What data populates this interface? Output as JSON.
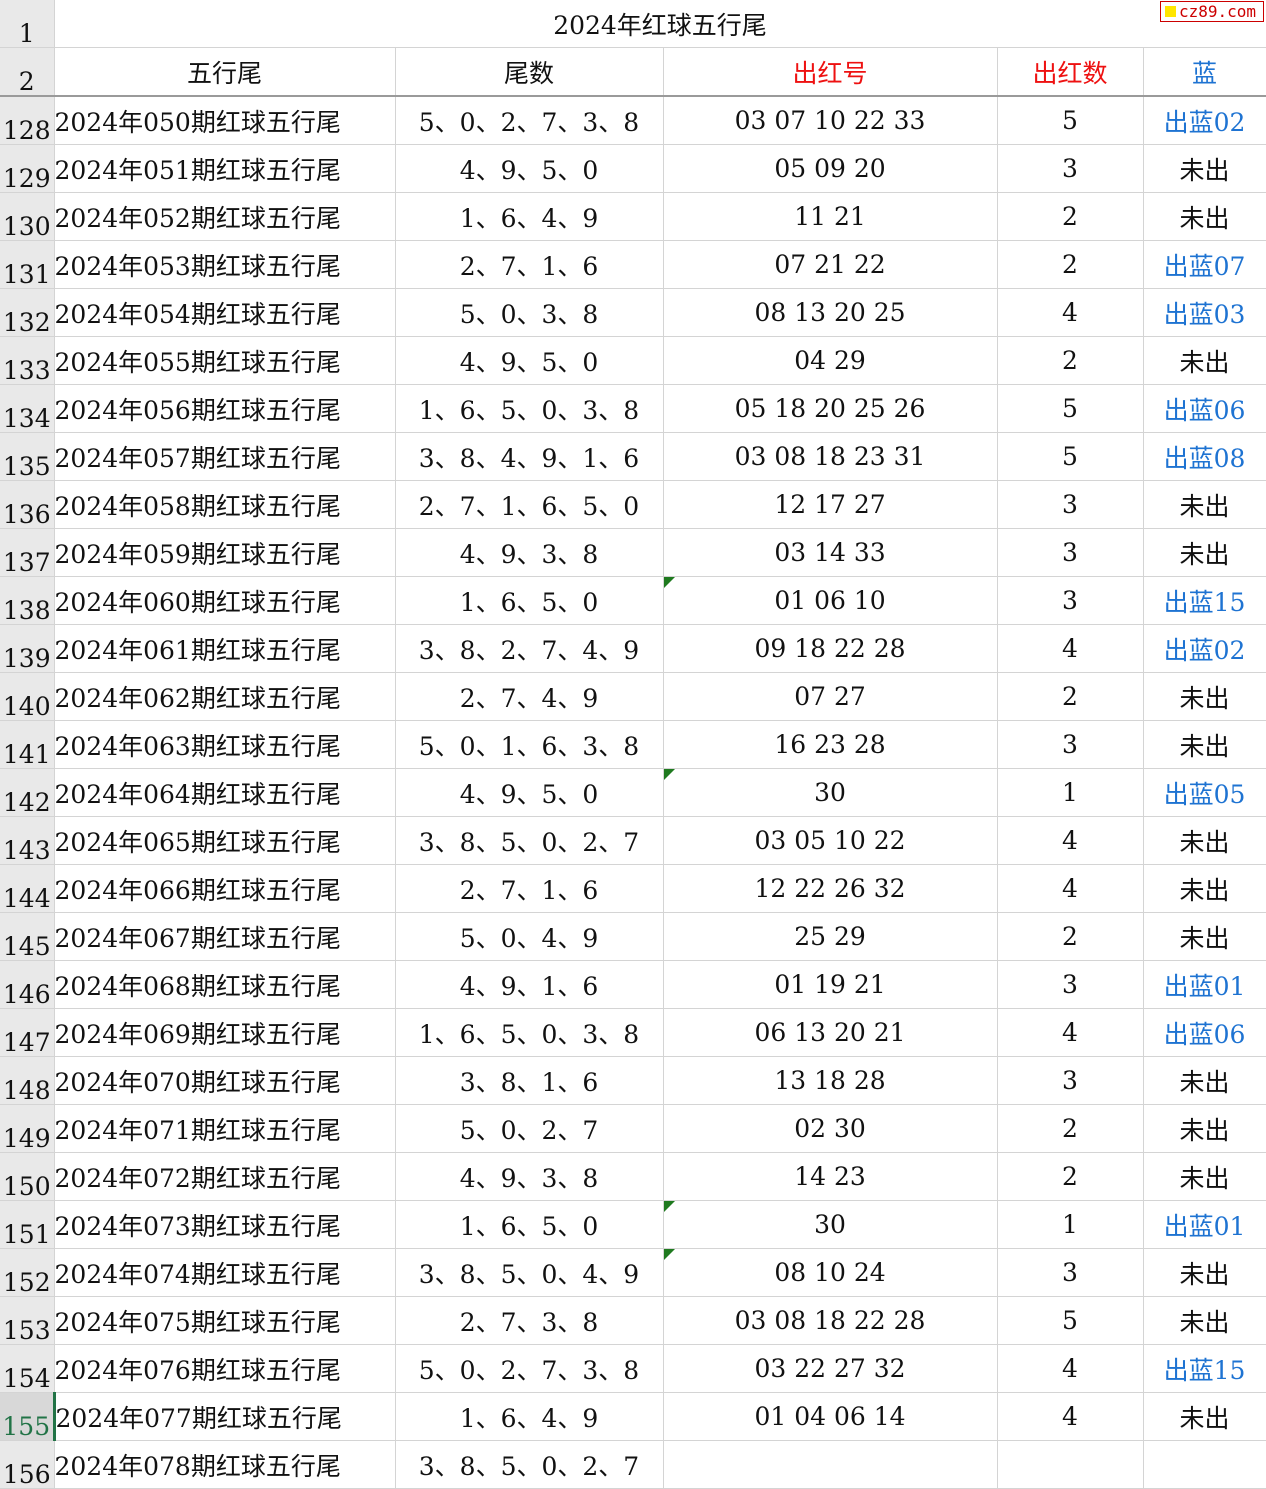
{
  "title": "2024年红球五行尾",
  "watermark": "cz89.com",
  "headers": {
    "row_title": "1",
    "row_header": "2",
    "name": "五行尾",
    "tail": "尾数",
    "red_numbers": "出红号",
    "red_count": "出红数",
    "blue": "蓝"
  },
  "rows": [
    {
      "row": "128",
      "name": "2024年050期红球五行尾",
      "tail": "5、0、2、7、3、8",
      "red": "03  07  10  22  33",
      "count": "5",
      "blue": "出蓝02"
    },
    {
      "row": "129",
      "name": "2024年051期红球五行尾",
      "tail": "4、9、5、0",
      "red": "05  09  20",
      "count": "3",
      "blue": "未出"
    },
    {
      "row": "130",
      "name": "2024年052期红球五行尾",
      "tail": "1、6、4、9",
      "red": "11  21",
      "count": "2",
      "blue": "未出"
    },
    {
      "row": "131",
      "name": "2024年053期红球五行尾",
      "tail": "2、7、1、6",
      "red": "07  21  22",
      "count": "2",
      "blue": "出蓝07"
    },
    {
      "row": "132",
      "name": "2024年054期红球五行尾",
      "tail": "5、0、3、8",
      "red": "08  13  20  25",
      "count": "4",
      "blue": "出蓝03"
    },
    {
      "row": "133",
      "name": "2024年055期红球五行尾",
      "tail": "4、9、5、0",
      "red": "04  29",
      "count": "2",
      "blue": "未出"
    },
    {
      "row": "134",
      "name": "2024年056期红球五行尾",
      "tail": "1、6、5、0、3、8",
      "red": "05  18  20  25  26",
      "count": "5",
      "blue": "出蓝06"
    },
    {
      "row": "135",
      "name": "2024年057期红球五行尾",
      "tail": "3、8、4、9、1、6",
      "red": "03  08  18  23  31",
      "count": "5",
      "blue": "出蓝08"
    },
    {
      "row": "136",
      "name": "2024年058期红球五行尾",
      "tail": "2、7、1、6、5、0",
      "red": "12  17  27",
      "count": "3",
      "blue": "未出"
    },
    {
      "row": "137",
      "name": "2024年059期红球五行尾",
      "tail": "4、9、3、8",
      "red": "03  14  33",
      "count": "3",
      "blue": "未出"
    },
    {
      "row": "138",
      "name": "2024年060期红球五行尾",
      "tail": "1、6、5、0",
      "red": "01  06  10",
      "count": "3",
      "blue": "出蓝15"
    },
    {
      "row": "139",
      "name": "2024年061期红球五行尾",
      "tail": "3、8、2、7、4、9",
      "red": "09  18  22  28",
      "count": "4",
      "blue": "出蓝02"
    },
    {
      "row": "140",
      "name": "2024年062期红球五行尾",
      "tail": "2、7、4、9",
      "red": "07  27",
      "count": "2",
      "blue": "未出"
    },
    {
      "row": "141",
      "name": "2024年063期红球五行尾",
      "tail": "5、0、1、6、3、8",
      "red": "16  23  28",
      "count": "3",
      "blue": "未出"
    },
    {
      "row": "142",
      "name": "2024年064期红球五行尾",
      "tail": "4、9、5、0",
      "red": "30",
      "count": "1",
      "blue": "出蓝05"
    },
    {
      "row": "143",
      "name": "2024年065期红球五行尾",
      "tail": "3、8、5、0、2、7",
      "red": "03  05  10  22",
      "count": "4",
      "blue": "未出"
    },
    {
      "row": "144",
      "name": "2024年066期红球五行尾",
      "tail": "2、7、1、6",
      "red": "12  22  26  32",
      "count": "4",
      "blue": "未出"
    },
    {
      "row": "145",
      "name": "2024年067期红球五行尾",
      "tail": "5、0、4、9",
      "red": "25  29",
      "count": "2",
      "blue": "未出"
    },
    {
      "row": "146",
      "name": "2024年068期红球五行尾",
      "tail": "4、9、1、6",
      "red": "01  19  21",
      "count": "3",
      "blue": "出蓝01"
    },
    {
      "row": "147",
      "name": "2024年069期红球五行尾",
      "tail": "1、6、5、0、3、8",
      "red": "06  13  20  21",
      "count": "4",
      "blue": "出蓝06"
    },
    {
      "row": "148",
      "name": "2024年070期红球五行尾",
      "tail": "3、8、1、6",
      "red": "13  18  28",
      "count": "3",
      "blue": "未出"
    },
    {
      "row": "149",
      "name": "2024年071期红球五行尾",
      "tail": "5、0、2、7",
      "red": "02  30",
      "count": "2",
      "blue": "未出"
    },
    {
      "row": "150",
      "name": "2024年072期红球五行尾",
      "tail": "4、9、3、8",
      "red": "14  23",
      "count": "2",
      "blue": "未出"
    },
    {
      "row": "151",
      "name": "2024年073期红球五行尾",
      "tail": "1、6、5、0",
      "red": "30",
      "count": "1",
      "blue": "出蓝01"
    },
    {
      "row": "152",
      "name": "2024年074期红球五行尾",
      "tail": "3、8、5、0、4、9",
      "red": "08  10  24",
      "count": "3",
      "blue": "未出"
    },
    {
      "row": "153",
      "name": "2024年075期红球五行尾",
      "tail": "2、7、3、8",
      "red": "03  08  18  22  28",
      "count": "5",
      "blue": "未出"
    },
    {
      "row": "154",
      "name": "2024年076期红球五行尾",
      "tail": "5、0、2、7、3、8",
      "red": "03  22  27  32",
      "count": "4",
      "blue": "出蓝15"
    },
    {
      "row": "155",
      "name": "2024年077期红球五行尾",
      "tail": "1、6、4、9",
      "red": "01  04  06  14",
      "count": "4",
      "blue": "未出",
      "selected": true
    },
    {
      "row": "156",
      "name": "2024年078期红球五行尾",
      "tail": "3、8、5、0、2、7",
      "red": "",
      "count": "",
      "blue": ""
    }
  ],
  "flagged_rows": [
    "138",
    "142",
    "151",
    "152"
  ],
  "colors": {
    "red": "#ee1111",
    "blue": "#1e73d2",
    "comment_flag": "#1f7a1f",
    "selected_row_header": "#217346"
  }
}
